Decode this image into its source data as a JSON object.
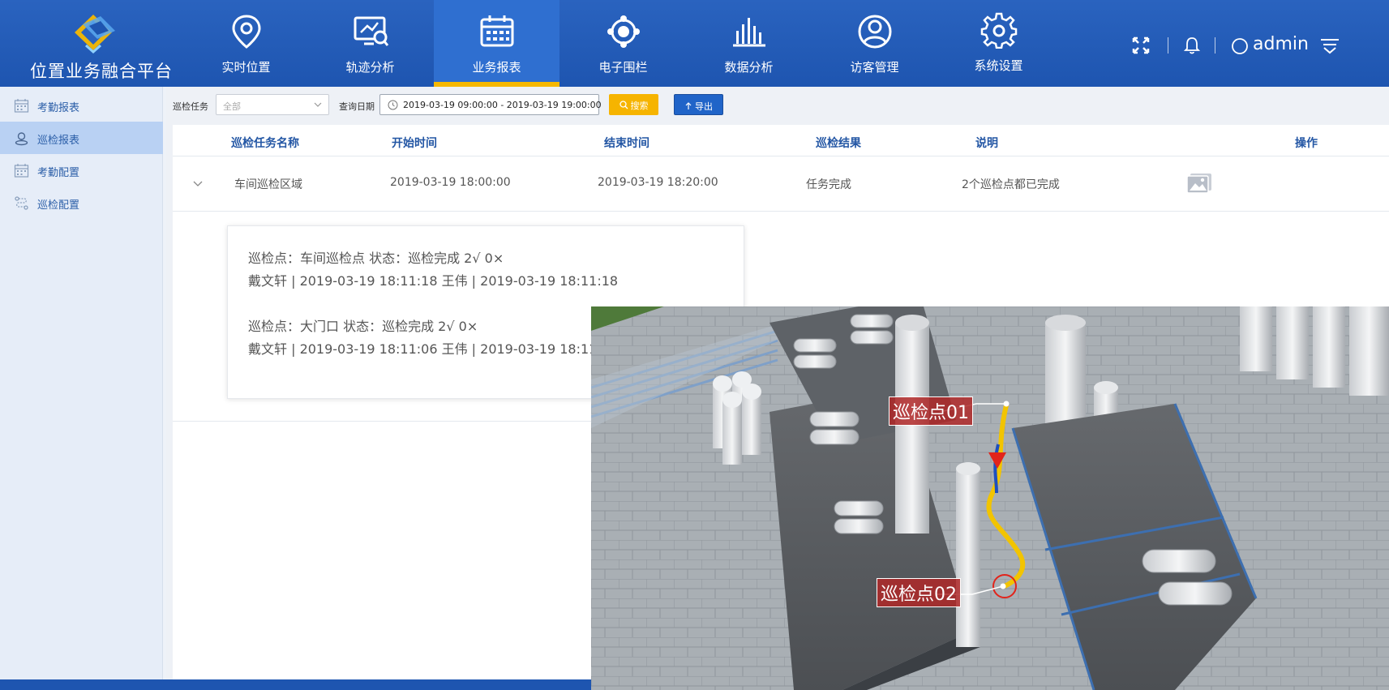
{
  "app": {
    "title": "位置业务融合平台"
  },
  "nav": [
    {
      "label": "实时位置",
      "icon": "map-pin-icon"
    },
    {
      "label": "轨迹分析",
      "icon": "track-monitor-icon"
    },
    {
      "label": "业务报表",
      "icon": "calendar-report-icon",
      "active": true
    },
    {
      "label": "电子围栏",
      "icon": "geofence-icon"
    },
    {
      "label": "数据分析",
      "icon": "bar-chart-icon"
    },
    {
      "label": "访客管理",
      "icon": "user-circle-icon"
    },
    {
      "label": "系统设置",
      "icon": "gear-icon"
    }
  ],
  "header_tools": {
    "user": "admin"
  },
  "sidebar": {
    "items": [
      {
        "label": "考勤报表",
        "icon": "calendar-icon"
      },
      {
        "label": "巡检报表",
        "icon": "location-person-icon",
        "active": true
      },
      {
        "label": "考勤配置",
        "icon": "calendar-icon"
      },
      {
        "label": "巡检配置",
        "icon": "route-icon"
      }
    ]
  },
  "filters": {
    "task_label": "巡检任务",
    "task_value": "全部",
    "date_label": "查询日期",
    "date_range": "2019-03-19 09:00:00  - 2019-03-19 19:00:00",
    "search_button": "搜索",
    "export_button": "导出"
  },
  "table": {
    "headers": [
      "巡检任务名称",
      "开始时间",
      "结束时间",
      "巡检结果",
      "说明",
      "操作"
    ],
    "rows": [
      {
        "name": "车间巡检区域",
        "start": "2019-03-19 18:00:00",
        "end": "2019-03-19 18:20:00",
        "result": "任务完成",
        "note": "2个巡检点都已完成"
      }
    ]
  },
  "detail": {
    "lines": [
      "巡检点：车间巡检点 状态：巡检完成 2√ 0×",
      "戴文轩 | 2019-03-19 18:11:18 王伟 | 2019-03-19 18:11:18",
      "巡检点：大门口 状态：巡检完成 2√ 0×",
      "戴文轩 | 2019-03-19 18:11:06 王伟 | 2019-03-19 18:11:"
    ]
  },
  "scene": {
    "labels": [
      "巡检点01",
      "巡检点02"
    ]
  },
  "colors": {
    "header_bg": "#1e55b0",
    "active_tab": "#2f6fd0",
    "accent": "#f6b800",
    "export": "#2064c8",
    "path": "#f2c400"
  }
}
